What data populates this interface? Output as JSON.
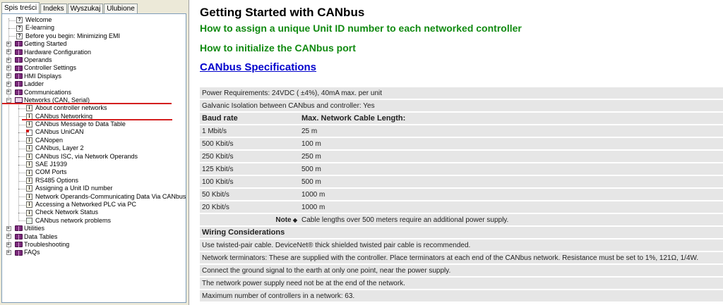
{
  "tabs": [
    "Spis treści",
    "Indeks",
    "Wyszukaj",
    "Ulubione"
  ],
  "tree": [
    {
      "label": "Welcome",
      "icon": "help-page-icon",
      "level": 1
    },
    {
      "label": "E-learning",
      "icon": "help-page-icon",
      "level": 1
    },
    {
      "label": "Before you begin: Minimizing EMI",
      "icon": "help-page-icon",
      "level": 1
    },
    {
      "label": "Getting Started",
      "icon": "book-icon",
      "level": 0,
      "expander": "+"
    },
    {
      "label": "Hardware Configuration",
      "icon": "book-icon",
      "level": 0,
      "expander": "+"
    },
    {
      "label": "Operands",
      "icon": "book-icon",
      "level": 0,
      "expander": "+"
    },
    {
      "label": "Controller Settings",
      "icon": "book-icon",
      "level": 0,
      "expander": "+"
    },
    {
      "label": "HMI Displays",
      "icon": "book-icon",
      "level": 0,
      "expander": "+"
    },
    {
      "label": "Ladder",
      "icon": "book-icon",
      "level": 0,
      "expander": "+"
    },
    {
      "label": "Communications",
      "icon": "book-icon",
      "level": 0,
      "expander": "+"
    },
    {
      "label": "Networks (CAN, Serial)",
      "icon": "open-book-icon",
      "level": 0,
      "expander": "−"
    },
    {
      "label": "About controller networks",
      "icon": "page-icon",
      "level": 2
    },
    {
      "label": "CANbus Networking",
      "icon": "page-icon",
      "level": 2
    },
    {
      "label": "CANbus Message to Data Table",
      "icon": "page-icon",
      "level": 2
    },
    {
      "label": "CANbus UniCAN",
      "icon": "page-red-icon",
      "level": 2
    },
    {
      "label": "CANopen",
      "icon": "page-icon",
      "level": 2
    },
    {
      "label": "CANbus, Layer 2",
      "icon": "page-icon",
      "level": 2
    },
    {
      "label": "CANbus ISC, via Network Operands",
      "icon": "page-icon",
      "level": 2
    },
    {
      "label": "SAE J1939",
      "icon": "page-icon",
      "level": 2
    },
    {
      "label": "COM Ports",
      "icon": "page-icon",
      "level": 2
    },
    {
      "label": "RS485 Options",
      "icon": "page-icon",
      "level": 2
    },
    {
      "label": "Assigning a Unit ID number",
      "icon": "page-icon",
      "level": 2
    },
    {
      "label": "Network Operands-Communicating Data Via CANbus",
      "icon": "page-icon",
      "level": 2
    },
    {
      "label": "Accessing a Networked PLC via PC",
      "icon": "page-icon",
      "level": 2
    },
    {
      "label": "Check Network Status",
      "icon": "page-icon",
      "level": 2
    },
    {
      "label": "CANbus network problems",
      "icon": "page-link-icon",
      "level": 2
    },
    {
      "label": "Utilities",
      "icon": "book-icon",
      "level": 0,
      "expander": "+"
    },
    {
      "label": "Data Tables",
      "icon": "book-icon",
      "level": 0,
      "expander": "+"
    },
    {
      "label": "Troubleshooting",
      "icon": "book-icon",
      "level": 0,
      "expander": "+"
    },
    {
      "label": "FAQs",
      "icon": "book-icon",
      "level": 0,
      "expander": "+"
    }
  ],
  "content": {
    "title": "Getting Started with CANbus",
    "link1": "How to assign a unique Unit ID number to each networked controller",
    "link2": "How to initialize the CANbus port",
    "spec_link": "CANbus Specifications",
    "power": "Power Requirements: 24VDC ( ±4%), 40mA max. per unit",
    "isolation": "Galvanic Isolation between CANbus and controller: Yes",
    "baud_header": "Baud rate",
    "cable_header": "Max. Network Cable Length:",
    "rates": [
      {
        "baud": "1     Mbit/s",
        "length": " 25 m"
      },
      {
        "baud": "500 Kbit/s",
        "length": "100 m"
      },
      {
        "baud": "250 Kbit/s",
        "length": "250 m"
      },
      {
        "baud": "125 Kbit/s",
        "length": "500 m"
      },
      {
        "baud": "100 Kbit/s",
        "length": "500 m"
      },
      {
        "baud": "50   Kbit/s",
        "length": "1000 m"
      },
      {
        "baud": "20   Kbit/s",
        "length": "1000 m"
      }
    ],
    "note_label": "Note",
    "note_text": "Cable lengths over 500 meters require an additional power supply.",
    "wiring_header": "Wiring Considerations",
    "wiring": [
      "Use twisted-pair cable.  DeviceNet® thick shielded twisted pair cable is recommended.",
      "Network terminators: These are supplied with the controller.  Place terminators at each end of the CANbus network. Resistance must be set to 1%, 121Ω, 1/4W.",
      "Connect the ground signal to the earth at only one point, near the power supply.",
      "The network power supply need not be at the end of the network.",
      "Maximum number of controllers in a network: 63."
    ]
  }
}
